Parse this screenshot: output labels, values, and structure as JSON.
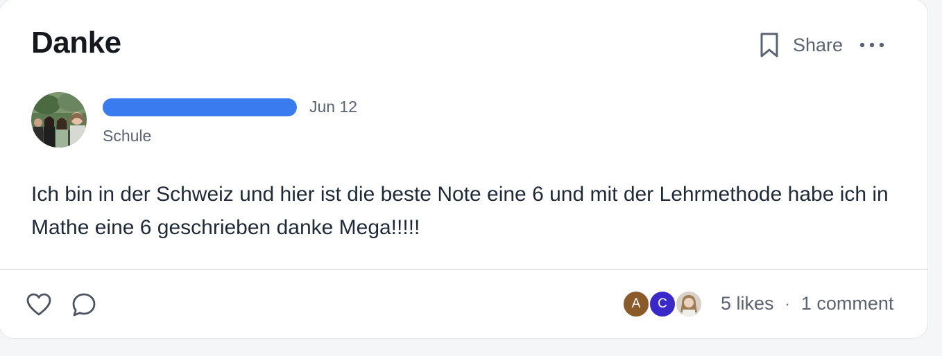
{
  "post": {
    "title": "Danke",
    "date": "Jun 12",
    "category": "Schule",
    "body": "Ich bin in der Schweiz und hier ist die beste Note eine 6 und mit der Lehrmethode habe ich in Mathe eine 6 geschrieben danke Mega!!!!!"
  },
  "actions": {
    "share_label": "Share",
    "bookmark_icon": "bookmark-icon",
    "more_icon": "more-icon"
  },
  "footer": {
    "likes_label": "5 likes",
    "separator": "·",
    "comments_label": "1 comment",
    "likers": [
      {
        "initial": "A",
        "color": "#8b5a2b"
      },
      {
        "initial": "C",
        "color": "#3b28c9"
      },
      {
        "initial": "",
        "color": "#d9cfc4"
      }
    ]
  },
  "colors": {
    "author_redaction": "#3b7bf0",
    "muted_text": "#5b6270",
    "border": "#e3e5e9"
  }
}
